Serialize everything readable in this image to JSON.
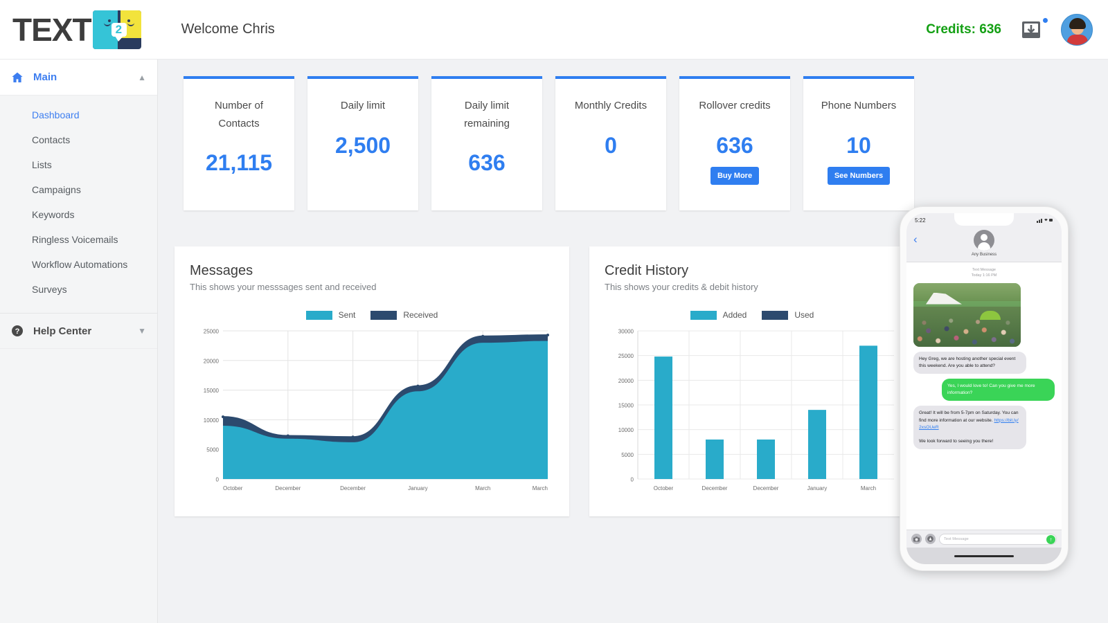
{
  "brand": {
    "logo_text": "TEXT",
    "logo_bubble_digit": "2"
  },
  "header": {
    "welcome": "Welcome Chris",
    "credits_label": "Credits: 636",
    "credits_color": "#14a014",
    "inbox_icon": "inbox-download-icon",
    "avatar_icon": "user-avatar"
  },
  "sidebar": {
    "main": {
      "label": "Main",
      "icon": "home-icon",
      "chevron": "▲"
    },
    "items": [
      {
        "label": "Dashboard",
        "active": true
      },
      {
        "label": "Contacts",
        "active": false
      },
      {
        "label": "Lists",
        "active": false
      },
      {
        "label": "Campaigns",
        "active": false
      },
      {
        "label": "Keywords",
        "active": false
      },
      {
        "label": "Ringless Voicemails",
        "active": false
      },
      {
        "label": "Workflow Automations",
        "active": false
      },
      {
        "label": "Surveys",
        "active": false
      }
    ],
    "help": {
      "label": "Help Center",
      "icon": "question-circle-icon",
      "chevron": "▼"
    }
  },
  "cards": [
    {
      "title": "Number of Contacts",
      "value": "21,115",
      "button": null
    },
    {
      "title": "Daily limit",
      "value": "2,500",
      "button": null
    },
    {
      "title": "Daily limit remaining",
      "value": "636",
      "button": null
    },
    {
      "title": "Monthly Credits",
      "value": "0",
      "button": null
    },
    {
      "title": "Rollover credits",
      "value": "636",
      "button": "Buy More"
    },
    {
      "title": "Phone Numbers",
      "value": "10",
      "button": "See Numbers"
    }
  ],
  "panels": {
    "messages": {
      "title": "Messages",
      "subtitle": "This shows your messsages sent and received"
    },
    "credit": {
      "title": "Credit History",
      "subtitle": "This shows your credits & debit history"
    }
  },
  "colors": {
    "accent_blue": "#2f7ef0",
    "cyan": "#29abca",
    "navy": "#2c4a6e",
    "green": "#14a014"
  },
  "chart_data": [
    {
      "type": "area",
      "title": "Messages",
      "subtitle": "This shows your messsages sent and received",
      "categories": [
        "October",
        "December",
        "December",
        "January",
        "March",
        "March"
      ],
      "series": [
        {
          "name": "Sent",
          "color": "#29abca",
          "values": [
            9000,
            6800,
            6200,
            14800,
            23000,
            23300
          ]
        },
        {
          "name": "Received",
          "color": "#2c4a6e",
          "values": [
            10500,
            7300,
            7100,
            15700,
            24100,
            24300
          ]
        }
      ],
      "xlabel": "",
      "ylabel": "",
      "ylim": [
        0,
        25000
      ],
      "yticks": [
        0,
        5000,
        10000,
        15000,
        20000,
        25000
      ],
      "grid": true,
      "legend": "top-center"
    },
    {
      "type": "bar",
      "title": "Credit History",
      "subtitle": "This shows your credits & debit history",
      "categories": [
        "October",
        "December",
        "December",
        "January",
        "March"
      ],
      "series": [
        {
          "name": "Added",
          "color": "#29abca",
          "values": [
            24800,
            8000,
            8000,
            14000,
            27000
          ]
        },
        {
          "name": "Used",
          "color": "#2c4a6e",
          "values": [
            0,
            0,
            0,
            0,
            0
          ]
        }
      ],
      "xlabel": "",
      "ylabel": "",
      "ylim": [
        0,
        30000
      ],
      "yticks": [
        0,
        5000,
        10000,
        15000,
        20000,
        25000,
        30000
      ],
      "grid": true,
      "legend": "top-center"
    }
  ],
  "phone": {
    "status_time": "5:22",
    "contact_name": "Any Business",
    "meta": "Text Message\nToday 1:16 PM",
    "messages": [
      {
        "side": "in",
        "text": "Hey Greg, we are hosting another special event this weekend. Are you able to attend?"
      },
      {
        "side": "out",
        "text": "Yes, I would love to! Can you give me more information?"
      },
      {
        "side": "in",
        "text": "Great! It will be from 5-7pm on Saturday. You can find more information at our website.",
        "link": "https://bit.ly/2xsOUeR",
        "text2": "We look forward to seeing you there!"
      }
    ],
    "input_placeholder": "Text Message",
    "camera_icon": "camera-icon",
    "apps_icon": "app-store-icon",
    "send_icon": "send-arrow-icon"
  }
}
